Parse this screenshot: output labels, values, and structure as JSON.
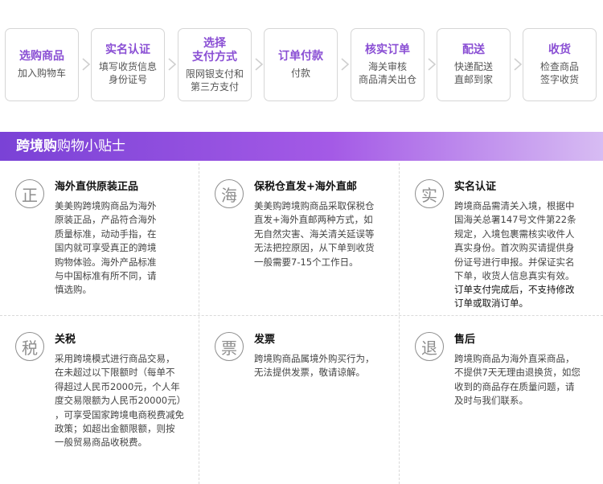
{
  "steps": [
    {
      "title": "选购商品",
      "desc": "加入购物车"
    },
    {
      "title": "实名认证",
      "desc": "填写收货信息\n身份证号"
    },
    {
      "title": "选择\n支付方式",
      "desc": "限网银支付和\n第三方支付"
    },
    {
      "title": "订单付款",
      "desc": "付款"
    },
    {
      "title": "核实订单",
      "desc": "海关审核\n商品清关出仓"
    },
    {
      "title": "配送",
      "desc": "快递配送\n直邮到家"
    },
    {
      "title": "收货",
      "desc": "检查商品\n签字收货"
    }
  ],
  "banner": {
    "bold": "跨境购",
    "rest": "购物小贴士"
  },
  "tips": [
    {
      "icon_char": "正",
      "title": "海外直供原装正品",
      "body": "美美购跨境购商品为海外\n原装正品，产品符合海外\n质量标准，动动手指，在\n国内就可享受真正的跨境\n购物体验。海外产品标准\n与中国标准有所不同，请\n慎选购。"
    },
    {
      "icon_char": "海",
      "title": "保税仓直发+海外直邮",
      "body": "美美购跨境购商品采取保税仓\n直发+海外直邮两种方式，如\n无自然灾害、海关清关延误等\n无法把控原因，从下单到收货\n一般需要7-15个工作日。"
    },
    {
      "icon_char": "实",
      "title": "实名认证",
      "body": "跨境商品需清关入境，根据中\n国海关总署147号文件第22条\n规定，入境包裹需核实收件人\n真实身份。首次购买请提供身\n份证号进行申报。并保证实名\n下单，收货人信息真实有效。",
      "note": "订单支付完成后，不支持修改\n订单或取消订单。"
    },
    {
      "icon_char": "税",
      "title": "关税",
      "body": "采用跨境模式进行商品交易，\n在未超过以下限额时（每单不\n得超过人民币2000元，个人年\n度交易限额为人民币20000元）\n，可享受国家跨境电商税费减免\n政策；如超出金额限额，则按\n一般贸易商品收税费。"
    },
    {
      "icon_char": "票",
      "title": "发票",
      "body": "跨境购商品属境外购买行为，\n无法提供发票，敬请谅解。"
    },
    {
      "icon_char": "退",
      "title": "售后",
      "body": "跨境购商品为海外直采商品，\n不提供7天无理由退换货，如您\n收到的商品存在质量问题，请\n及时与我们联系。"
    }
  ],
  "colors": {
    "accent": "#8a4fd4",
    "banner_start": "#7a42d6",
    "banner_end": "#d7bcf3",
    "text": "#111111",
    "muted": "#8e8e8e"
  }
}
